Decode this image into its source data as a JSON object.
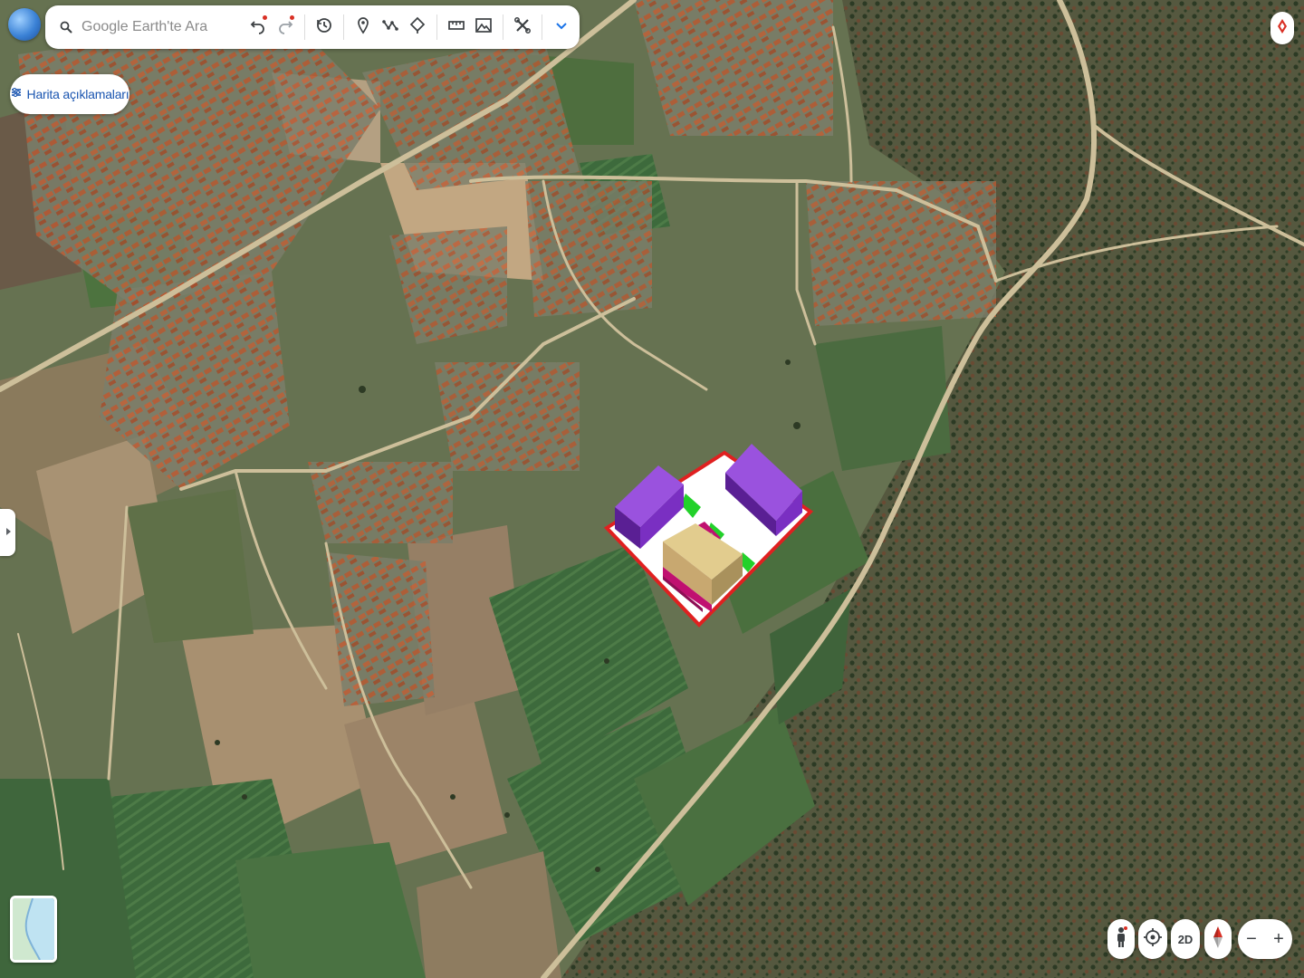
{
  "app": {
    "name": "Google Earth"
  },
  "search": {
    "placeholder": "Google Earth'te Ara",
    "value": ""
  },
  "toolbar": {
    "buttons": [
      {
        "icon": "undo-icon",
        "notify": true
      },
      {
        "icon": "redo-icon",
        "notify": true
      },
      {
        "icon": "history-icon",
        "notify": false
      },
      {
        "icon": "add-placemark-icon",
        "notify": false
      },
      {
        "icon": "draw-path-icon",
        "notify": false
      },
      {
        "icon": "add-polygon-icon",
        "notify": false
      },
      {
        "icon": "measure-icon",
        "notify": false
      },
      {
        "icon": "capture-image-icon",
        "notify": false
      },
      {
        "icon": "tools-icon",
        "notify": false
      },
      {
        "icon": "chevron-down-icon",
        "notify": false
      }
    ]
  },
  "legend_button": {
    "label": "Harita açıklamaları",
    "icon": "layers-icon"
  },
  "bottom_controls": {
    "pegman": "pegman-icon",
    "my_location": "my-location-icon",
    "view_toggle_label": "2D",
    "compass": "compass-icon",
    "zoom_out": "−",
    "zoom_in": "+"
  },
  "colors": {
    "accent": "#1a55b0",
    "notify_dot": "#d93025",
    "building_purple": "#7a2fc2",
    "building_tan": "#e2cc8e",
    "building_magenta": "#c01070",
    "site_outline": "#e02020",
    "green_markers": "#22d12a"
  }
}
